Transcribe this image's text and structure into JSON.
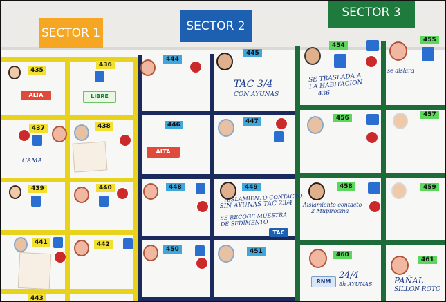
{
  "sectors": [
    {
      "label": "SECTOR 1",
      "color": "#f5a623"
    },
    {
      "label": "SECTOR 2",
      "color": "#1d5fb0"
    },
    {
      "label": "SECTOR 3",
      "color": "#1f7a3e"
    }
  ],
  "beds": {
    "435": "435",
    "436": "436",
    "437": "437",
    "438": "438",
    "439": "439",
    "440": "440",
    "441": "441",
    "442": "442",
    "443": "443",
    "444": "444",
    "445": "445",
    "446": "446",
    "447": "447",
    "448": "448",
    "449": "449",
    "450": "450",
    "451": "451",
    "454": "454",
    "455": "455",
    "456": "456",
    "457": "457",
    "458": "458",
    "459": "459",
    "460": "460",
    "461": "461"
  },
  "tags": {
    "alta": "ALTA",
    "libre": "LIBRE",
    "tac": "TAC",
    "rnm": "RNM"
  },
  "notes": {
    "cama": "CAMA",
    "note_445": [
      "TAC 3/4",
      "CON AYUNAS"
    ],
    "note_454": [
      "SE TRASLADA A",
      "LA HABITACION",
      "436"
    ],
    "note_455": "se aislara",
    "note_449": [
      "AISLAMIENTO CONTACTO",
      "SIN AYUNAS TAC 23/4",
      "SE RECOGE MUESTRA",
      "DE SEDIMENTO"
    ],
    "note_458": [
      "Aislamiento contacto",
      "2 Mupirocina"
    ],
    "note_460": [
      "24/4",
      "8h AYUNAS"
    ],
    "note_461": [
      "PAÑAL",
      "SILLON ROTO"
    ]
  }
}
